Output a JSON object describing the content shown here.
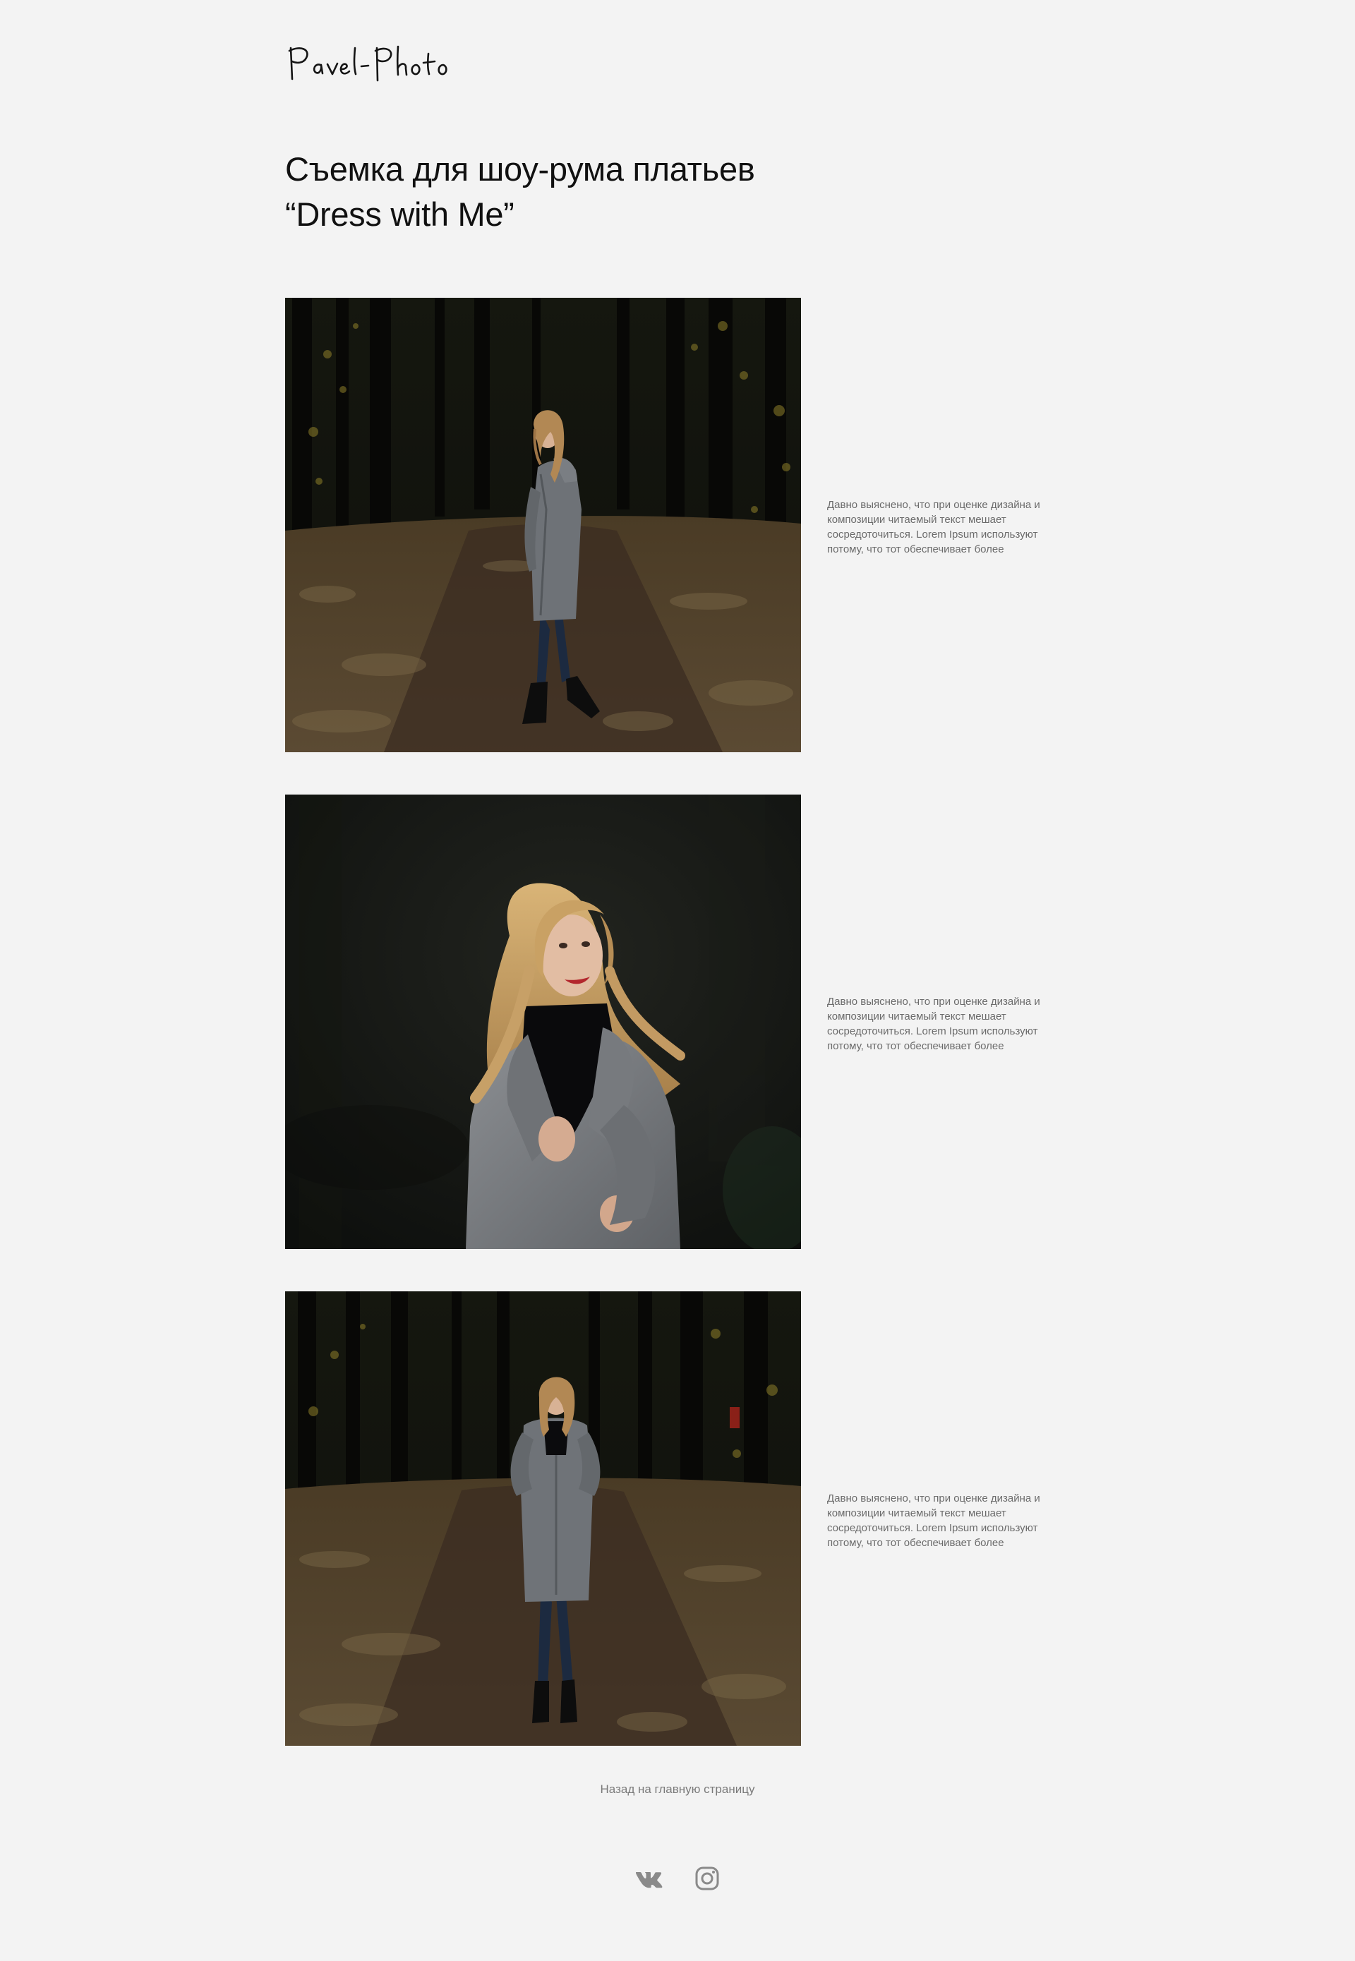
{
  "header": {
    "logo_text": "Pavel-Photo"
  },
  "page": {
    "title_line1": "Съемка для шоу-рума платьев",
    "title_line2": "“Dress with Me”"
  },
  "gallery": [
    {
      "caption": "Давно выяснено, что при оценке дизайна и композиции читаемый текст мешает сосредоточиться. Lorem Ipsum используют потому, что тот обеспечивает более"
    },
    {
      "caption": "Давно выяснено, что при оценке дизайна и композиции читаемый текст мешает сосредоточиться. Lorem Ipsum используют потому, что тот обеспечивает более"
    },
    {
      "caption": "Давно выяснено, что при оценке дизайна и композиции читаемый текст мешает сосредоточиться. Lorem Ipsum используют потому, что тот обеспечивает более"
    }
  ],
  "footer": {
    "back_link": "Назад на главную страницу",
    "socials": [
      {
        "icon": "vk-icon"
      },
      {
        "icon": "instagram-icon"
      }
    ]
  },
  "colors": {
    "background": "#f3f3f3",
    "title": "#111111",
    "caption": "#6b6b6b",
    "link": "#7a7a7a",
    "icons": "#8a8a8a"
  }
}
